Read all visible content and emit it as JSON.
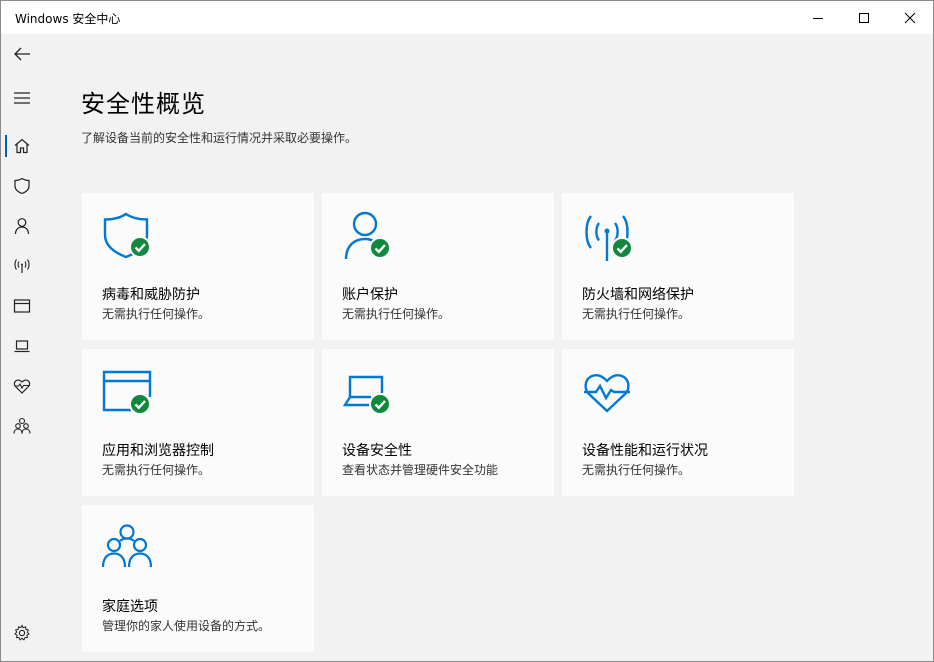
{
  "window": {
    "title": "Windows 安全中心"
  },
  "colors": {
    "accent": "#0063b1",
    "icon_blue": "#0078d4",
    "check_green": "#10893e",
    "sidebar_bg": "#f2f2f2",
    "tile_bg": "#fbfbfb"
  },
  "sidebar": {
    "items": [
      {
        "icon": "back-arrow-icon"
      },
      {
        "icon": "hamburger-menu-icon"
      },
      {
        "icon": "home-icon",
        "active": true
      },
      {
        "icon": "shield-icon"
      },
      {
        "icon": "person-icon"
      },
      {
        "icon": "wireless-signal-icon"
      },
      {
        "icon": "browser-window-icon"
      },
      {
        "icon": "laptop-icon"
      },
      {
        "icon": "heart-pulse-icon"
      },
      {
        "icon": "family-icon"
      },
      {
        "icon": "gear-icon"
      }
    ]
  },
  "main": {
    "title": "安全性概览",
    "subtitle": "了解设备当前的安全性和运行情况并采取必要操作。",
    "tiles": [
      {
        "icon": "shield-check-icon",
        "title": "病毒和威胁防护",
        "status": "无需执行任何操作。"
      },
      {
        "icon": "account-check-icon",
        "title": "账户保护",
        "status": "无需执行任何操作。"
      },
      {
        "icon": "firewall-network-check-icon",
        "title": "防火墙和网络保护",
        "status": "无需执行任何操作。"
      },
      {
        "icon": "app-browser-check-icon",
        "title": "应用和浏览器控制",
        "status": "无需执行任何操作。"
      },
      {
        "icon": "device-security-check-icon",
        "title": "设备安全性",
        "status": "查看状态并管理硬件安全功能"
      },
      {
        "icon": "heart-pulse-icon",
        "title": "设备性能和运行状况",
        "status": "无需执行任何操作。"
      },
      {
        "icon": "family-icon",
        "title": "家庭选项",
        "status": "管理你的家人使用设备的方式。"
      }
    ]
  }
}
